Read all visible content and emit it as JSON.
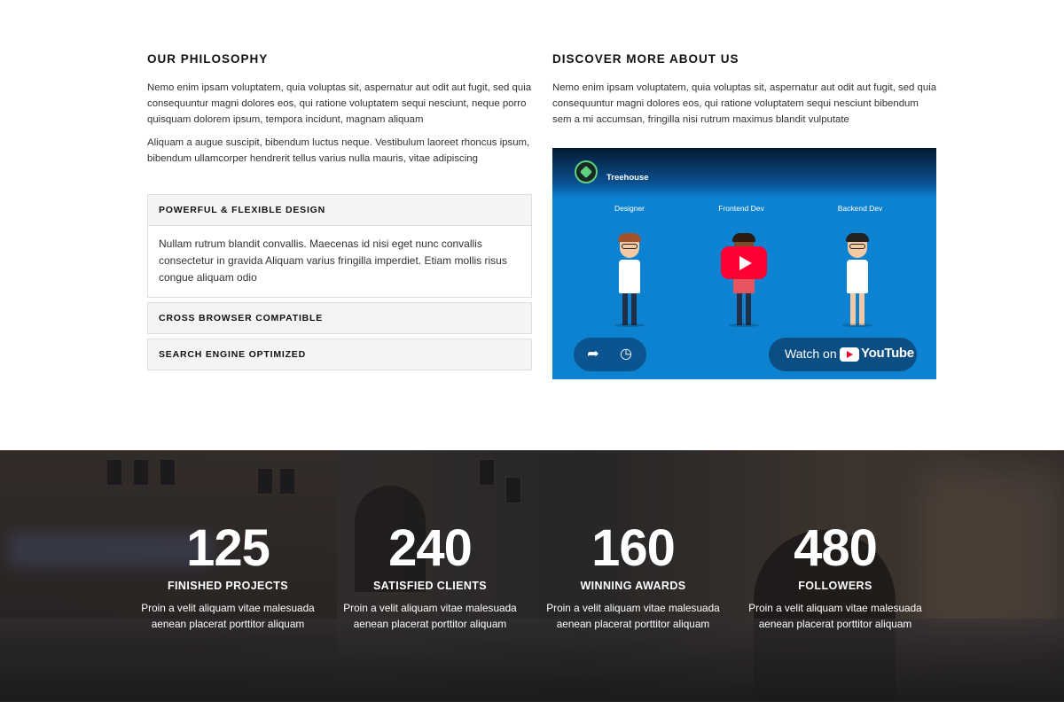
{
  "philosophy": {
    "heading": "OUR PHILOSOPHY",
    "paragraph1": "Nemo enim ipsam voluptatem, quia voluptas sit, aspernatur aut odit aut fugit, sed quia consequuntur magni dolores eos, qui ratione voluptatem sequi nesciunt, neque porro quisquam dolorem ipsum, tempora incidunt, magnam aliquam",
    "paragraph2": "Aliquam a augue suscipit, bibendum luctus neque. Vestibulum laoreet rhoncus ipsum, bibendum ullamcorper hendrerit tellus varius nulla mauris, vitae adipiscing"
  },
  "accordion": [
    {
      "title": "POWERFUL & FLEXIBLE DESIGN",
      "expanded": true,
      "body": "Nullam rutrum blandit convallis. Maecenas id nisi eget nunc convallis consectetur in gravida Aliquam varius fringilla imperdiet. Etiam mollis risus congue aliquam odio"
    },
    {
      "title": "CROSS BROWSER COMPATIBLE",
      "expanded": false
    },
    {
      "title": "SEARCH ENGINE OPTIMIZED",
      "expanded": false
    }
  ],
  "discover": {
    "heading": "DISCOVER MORE ABOUT US",
    "paragraph": "Nemo enim ipsam voluptatem, quia voluptas sit, aspernatur aut odit aut fugit, sed quia consequuntur magni dolores eos, qui ratione voluptatem sequi nesciunt bibendum sem a mi accumsan, fringilla nisi rutrum maximus blandit vulputate"
  },
  "video": {
    "channel_name": "Treehouse",
    "roles": [
      "Designer",
      "Frontend Dev",
      "Backend Dev"
    ],
    "watch_on": "Watch on",
    "platform": "YouTube",
    "share_icon": "share-icon",
    "watch_later_icon": "clock-icon",
    "play_icon": "play-icon",
    "background_color": "#0c82d0",
    "play_color": "#ff0033"
  },
  "stats": [
    {
      "number": "125",
      "label": "FINISHED PROJECTS",
      "desc_line1": "Proin a velit aliquam vitae malesuada",
      "desc_line2": "aenean placerat porttitor aliquam"
    },
    {
      "number": "240",
      "label": "SATISFIED CLIENTS",
      "desc_line1": "Proin a velit aliquam vitae malesuada",
      "desc_line2": "aenean placerat porttitor aliquam"
    },
    {
      "number": "160",
      "label": "WINNING AWARDS",
      "desc_line1": "Proin a velit aliquam vitae malesuada",
      "desc_line2": "aenean placerat porttitor aliquam"
    },
    {
      "number": "480",
      "label": "FOLLOWERS",
      "desc_line1": "Proin a velit aliquam vitae malesuada",
      "desc_line2": "aenean placerat porttitor aliquam"
    }
  ]
}
